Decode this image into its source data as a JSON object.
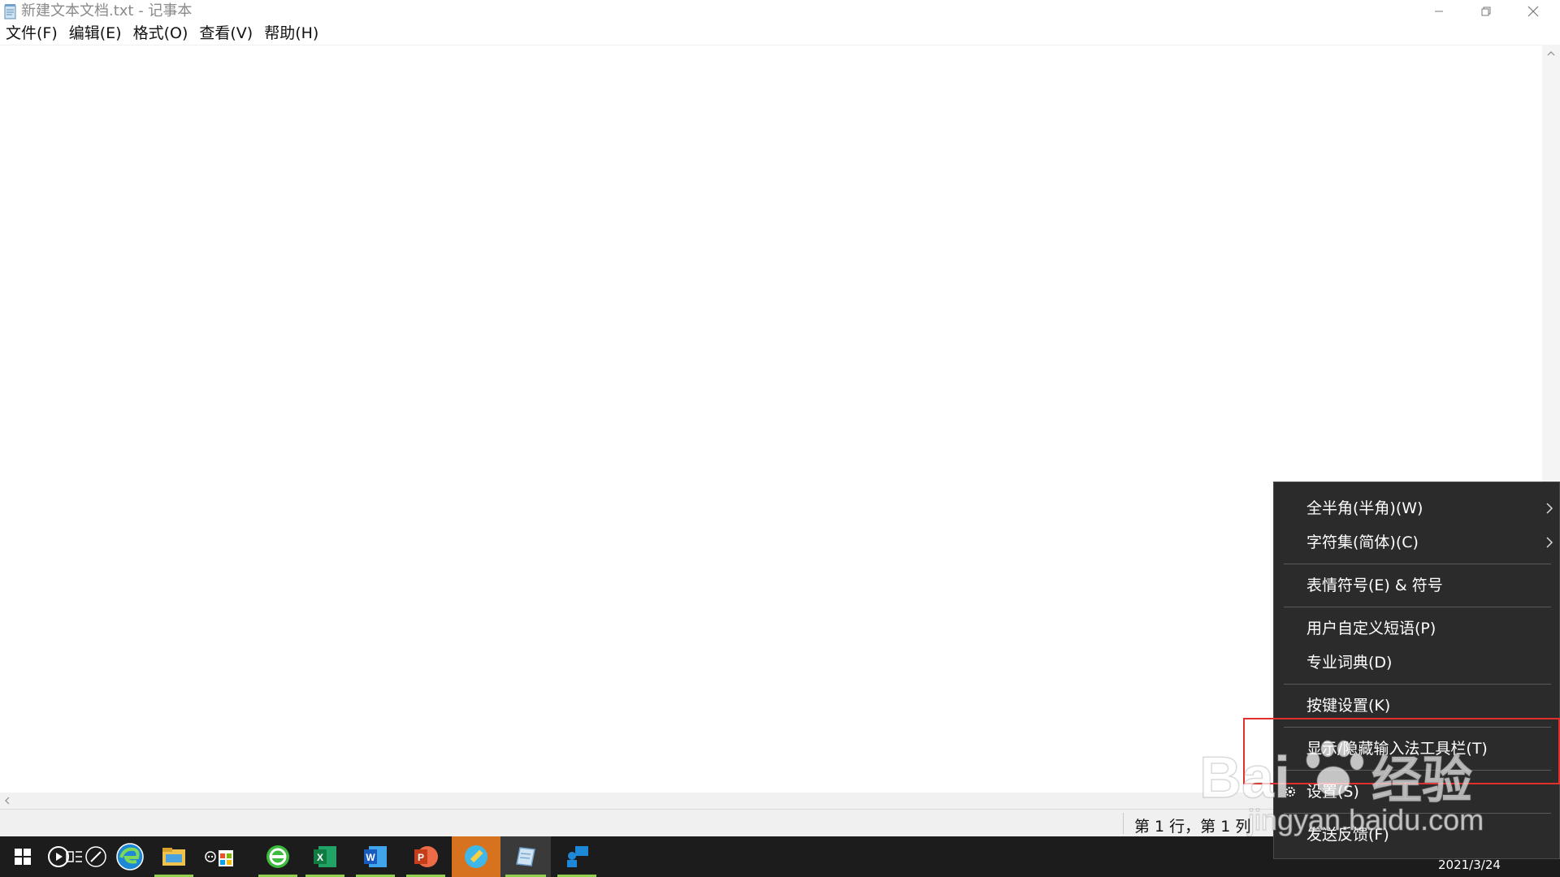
{
  "window": {
    "title": "新建文本文档.txt - 记事本"
  },
  "menubar": {
    "items": [
      "文件(F)",
      "编辑(E)",
      "格式(O)",
      "查看(V)",
      "帮助(H)"
    ]
  },
  "statusbar": {
    "position": "第 1 行，第 1 列"
  },
  "context_menu": {
    "items": [
      "全半角(半角)(W)",
      "字符集(简体)(C)",
      "表情符号(E) & 符号",
      "用户自定义短语(P)",
      "专业词典(D)",
      "按键设置(K)",
      "显示/隐藏输入法工具栏(T)",
      "设置(S)",
      "发送反馈(F)"
    ]
  },
  "taskbar": {
    "date": "2021/3/24"
  },
  "watermark": {
    "brand": "Bai",
    "brand_cn": "经验",
    "url": "jingyan.baidu.com"
  },
  "colors": {
    "accent_highlight": "#e0312f",
    "menu_bg": "#2b2b2b",
    "taskbar_bg": "#1c1c1c"
  }
}
